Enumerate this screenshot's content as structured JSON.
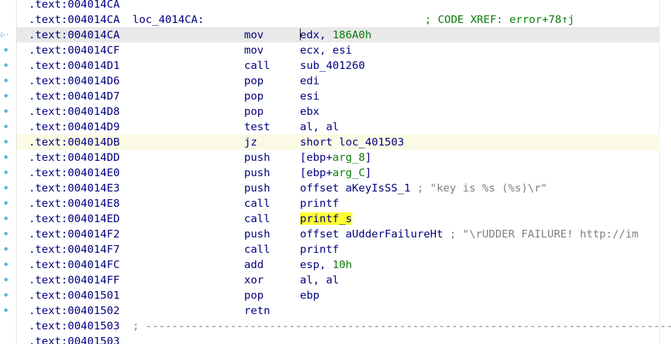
{
  "header": {
    "addr_prev": ".text:004014CA",
    "label_addr": ".text:004014CA",
    "label_name": "loc_4014CA:",
    "xref": "; CODE XREF: error+78↑j"
  },
  "instructions": [
    {
      "addr": ".text:004014CA",
      "mnem": "mov",
      "op1": "edx, ",
      "op2": "186A0h",
      "comment": ""
    },
    {
      "addr": ".text:004014CF",
      "mnem": "mov",
      "op1": "ecx, esi",
      "op2": "",
      "comment": ""
    },
    {
      "addr": ".text:004014D1",
      "mnem": "call",
      "op1": "sub_401260",
      "op2": "",
      "comment": ""
    },
    {
      "addr": ".text:004014D6",
      "mnem": "pop",
      "op1": "edi",
      "op2": "",
      "comment": ""
    },
    {
      "addr": ".text:004014D7",
      "mnem": "pop",
      "op1": "esi",
      "op2": "",
      "comment": ""
    },
    {
      "addr": ".text:004014D8",
      "mnem": "pop",
      "op1": "ebx",
      "op2": "",
      "comment": ""
    },
    {
      "addr": ".text:004014D9",
      "mnem": "test",
      "op1": "al, al",
      "op2": "",
      "comment": ""
    },
    {
      "addr": ".text:004014DB",
      "mnem": "jz",
      "op1": "short loc_401503",
      "op2": "",
      "comment": ""
    },
    {
      "addr": ".text:004014DD",
      "mnem": "push",
      "op1": "[ebp+",
      "op2": "arg_8",
      "op3": "]",
      "comment": ""
    },
    {
      "addr": ".text:004014E0",
      "mnem": "push",
      "op1": "[ebp+",
      "op2": "arg_C",
      "op3": "]",
      "comment": ""
    },
    {
      "addr": ".text:004014E3",
      "mnem": "push",
      "op1": "offset aKeyIsSS_1",
      "op2": "",
      "comment": " ; \"key is %s (%s)\\r\""
    },
    {
      "addr": ".text:004014E8",
      "mnem": "call",
      "op1": "printf",
      "op2": "",
      "comment": ""
    },
    {
      "addr": ".text:004014ED",
      "mnem": "call",
      "op1": "printf_s",
      "op2": "",
      "comment": ""
    },
    {
      "addr": ".text:004014F2",
      "mnem": "push",
      "op1": "offset aUdderFailureHt",
      "op2": "",
      "comment": " ; \"\\rUDDER FAILURE! http://im"
    },
    {
      "addr": ".text:004014F7",
      "mnem": "call",
      "op1": "printf",
      "op2": "",
      "comment": ""
    },
    {
      "addr": ".text:004014FC",
      "mnem": "add",
      "op1": "esp, ",
      "op2": "10h",
      "comment": ""
    },
    {
      "addr": ".text:004014FF",
      "mnem": "xor",
      "op1": "al, al",
      "op2": "",
      "comment": ""
    },
    {
      "addr": ".text:00401501",
      "mnem": "pop",
      "op1": "ebp",
      "op2": "",
      "comment": ""
    },
    {
      "addr": ".text:00401502",
      "mnem": "retn",
      "op1": "",
      "op2": "",
      "comment": ""
    }
  ],
  "separator": {
    "addr": ".text:00401503",
    "text": "; -----------------------------------------------------------------------------------------------"
  },
  "footer": {
    "addr_next": ".text:00401503"
  }
}
